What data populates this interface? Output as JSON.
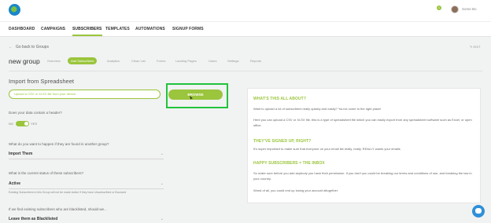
{
  "header": {
    "username": "Some Bo",
    "notification_count": "1"
  },
  "nav": {
    "items": [
      "DASHBOARD",
      "CAMPAIGNS",
      "SUBSCRIBERS",
      "TEMPLATES",
      "AUTOMATIONS",
      "SIGNUP FORMS"
    ],
    "active": "SUBSCRIBERS"
  },
  "breadcrumb": {
    "back_label": "Go back to Groups",
    "edit_label": "EDIT"
  },
  "page": {
    "title": "new group",
    "tabs": [
      "Overview",
      "Add Subscribers",
      "Analytics",
      "Clean List",
      "Forms",
      "Landing Pages",
      "Users",
      "Settings",
      "Reports"
    ],
    "active_tab": "Add Subscribers"
  },
  "import": {
    "title": "Import from Spreadsheet",
    "upload_placeholder": "Upload a CSV or XLSX file from your device",
    "browse_label": "BROWSE",
    "header_question": "Does your data contain a header?",
    "header_toggle_off": "NO",
    "header_toggle_on": "YES",
    "header_toggle_value": true,
    "group_question": "What do you want to happen if they are found in another group?",
    "group_value": "Import Them",
    "status_question": "What is the current status of these subscribers?",
    "status_value": "Active",
    "status_hint": "Existing Subscribers in this Group will not be made Active if they have Unsubscribed or Bounced",
    "blacklist_question": "If we find existing subscribers who are blacklisted, should we...",
    "blacklist_value": "Leave them as Blacklisted"
  },
  "info": {
    "heading1": "WHAT'S THIS ALL ABOUT?",
    "p1": "Want to upload a lot of subscribers really quickly and easily? You've come to the right place!",
    "p2": "Here you can upload a CSV or XLSX file, this is a type of spreadsheet file which you can easily export from any spreadsheet software such as Excel, or open office.",
    "heading2": "THEY'VE SIGNED UP, RIGHT?",
    "p3": "It's super important to make sure that everyone on your email list really, really, REALLY wants your emails",
    "heading3": "HAPPY SUBSCRIBERS = THE INBOX",
    "p4": "So make sure before you add anybody you have their permission. If you don't you could be breaking our terms and conditions of use, and breaking the law in your country.",
    "p5": "Worst of all, you could end up losing your account altogether"
  },
  "icons": {
    "logo": "logo-icon",
    "back": "arrow-left-icon",
    "chevron": "chevron-down-icon",
    "chat": "chat-icon"
  },
  "colors": {
    "accent": "#9ac53c",
    "highlight": "#22c33c",
    "chat": "#2f8fd8"
  }
}
